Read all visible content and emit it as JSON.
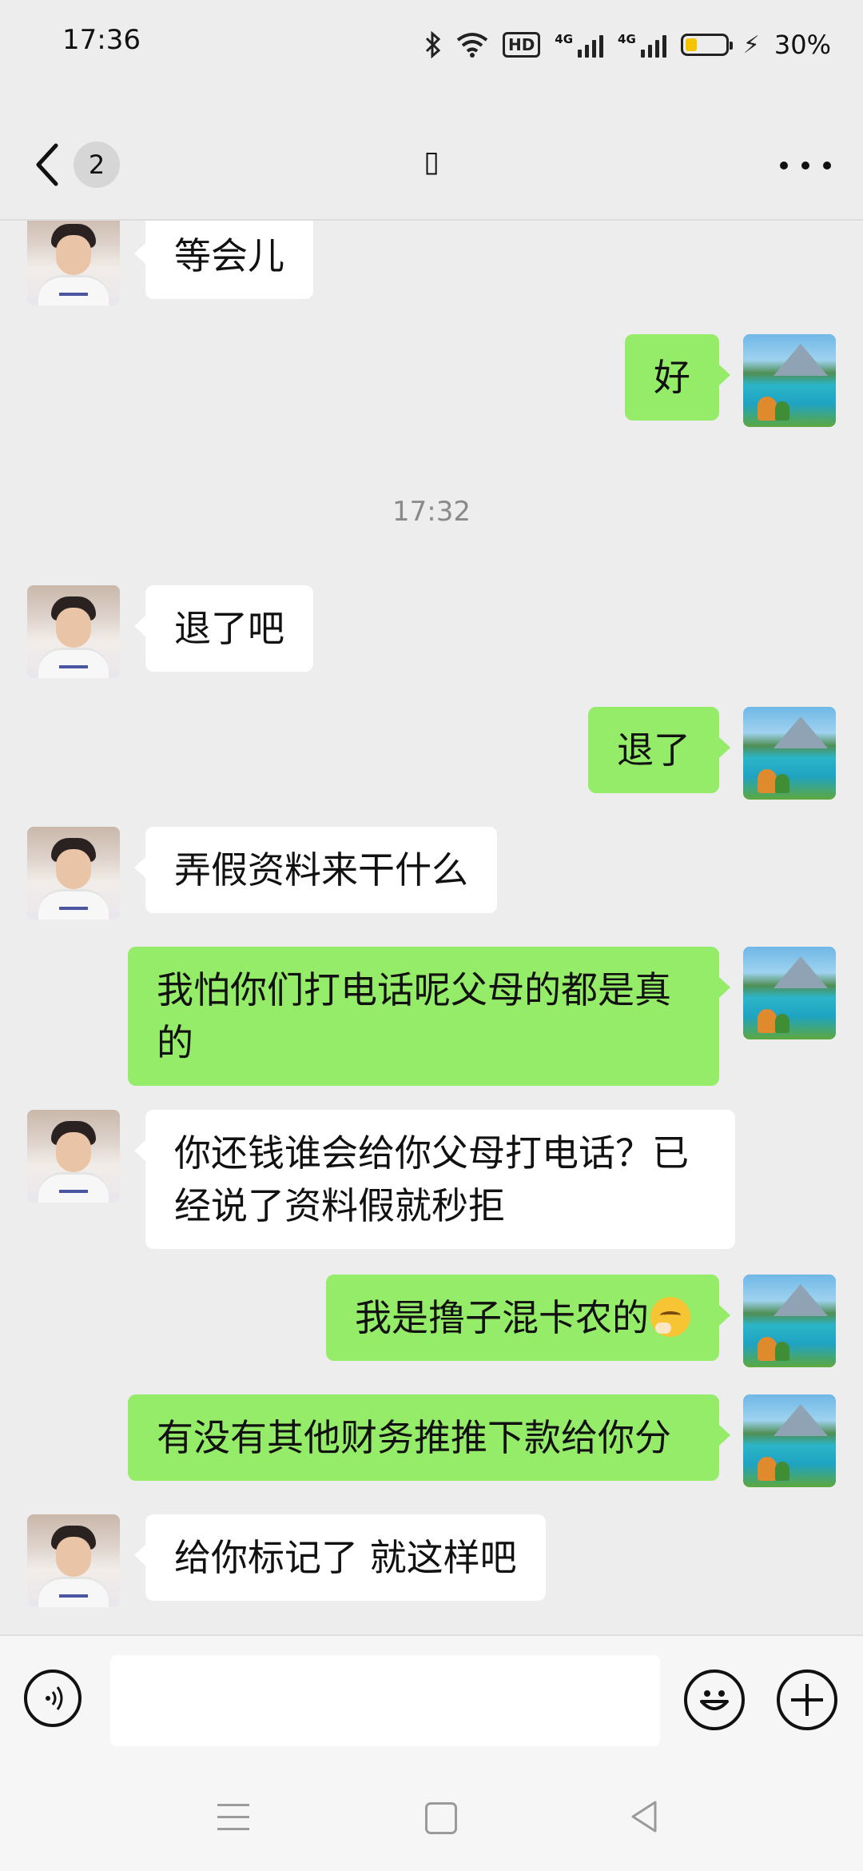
{
  "status_bar": {
    "time": "17:36",
    "icons": [
      "bluetooth-icon",
      "wifi-icon",
      "hd-icon",
      "signal-4g-icon",
      "signal-4g-icon",
      "battery-icon",
      "charging-icon"
    ],
    "hd_label": "HD",
    "network_label": "4G",
    "battery_percent": "30%",
    "battery_level": 0.3,
    "battery_color": "#f5c400"
  },
  "header": {
    "unread_count": "2",
    "title": "▯",
    "more_icon": "more-dots-icon",
    "back_icon": "chevron-left-icon"
  },
  "messages": [
    {
      "side": "in",
      "text": "等会儿"
    },
    {
      "side": "out",
      "text": "好"
    },
    {
      "type": "timestamp",
      "text": "17:32"
    },
    {
      "side": "in",
      "text": "退了吧"
    },
    {
      "side": "out",
      "text": "退了"
    },
    {
      "side": "in",
      "text": "弄假资料来干什么"
    },
    {
      "side": "out",
      "text": "我怕你们打电话呢父母的都是真的"
    },
    {
      "side": "in",
      "text": "你还钱谁会给你父母打电话？已经说了资料假就秒拒"
    },
    {
      "side": "out",
      "text": "我是撸子混卡农的",
      "emoji": "shushing-face-emoji"
    },
    {
      "side": "out",
      "text": "有没有其他财务推推下款给你分"
    },
    {
      "side": "in",
      "text": "给你标记了 就这样吧"
    }
  ],
  "input_bar": {
    "voice_icon": "voice-input-icon",
    "text_value": "",
    "emoji_icon": "emoji-icon",
    "plus_icon": "plus-icon"
  },
  "system_nav": {
    "icons": [
      "menu-icon",
      "home-icon",
      "back-triangle-icon"
    ]
  },
  "colors": {
    "background": "#ededed",
    "outgoing_bubble": "#95ec69",
    "incoming_bubble": "#ffffff"
  }
}
